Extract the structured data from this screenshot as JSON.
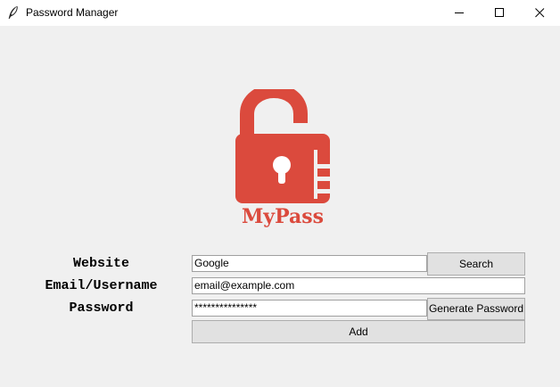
{
  "window": {
    "title": "Password Manager",
    "controls": [
      "minimize-icon",
      "maximize-icon",
      "close-icon"
    ]
  },
  "logo": {
    "text": "MyPass",
    "color": "#db4a3d"
  },
  "form": {
    "website_label": "Website",
    "website_value": "Google",
    "email_label": "Email/Username",
    "email_value": "email@example.com",
    "password_label": "Password",
    "password_value": "***************",
    "search_label": "Search",
    "generate_label": "Generate Password",
    "add_label": "Add"
  }
}
